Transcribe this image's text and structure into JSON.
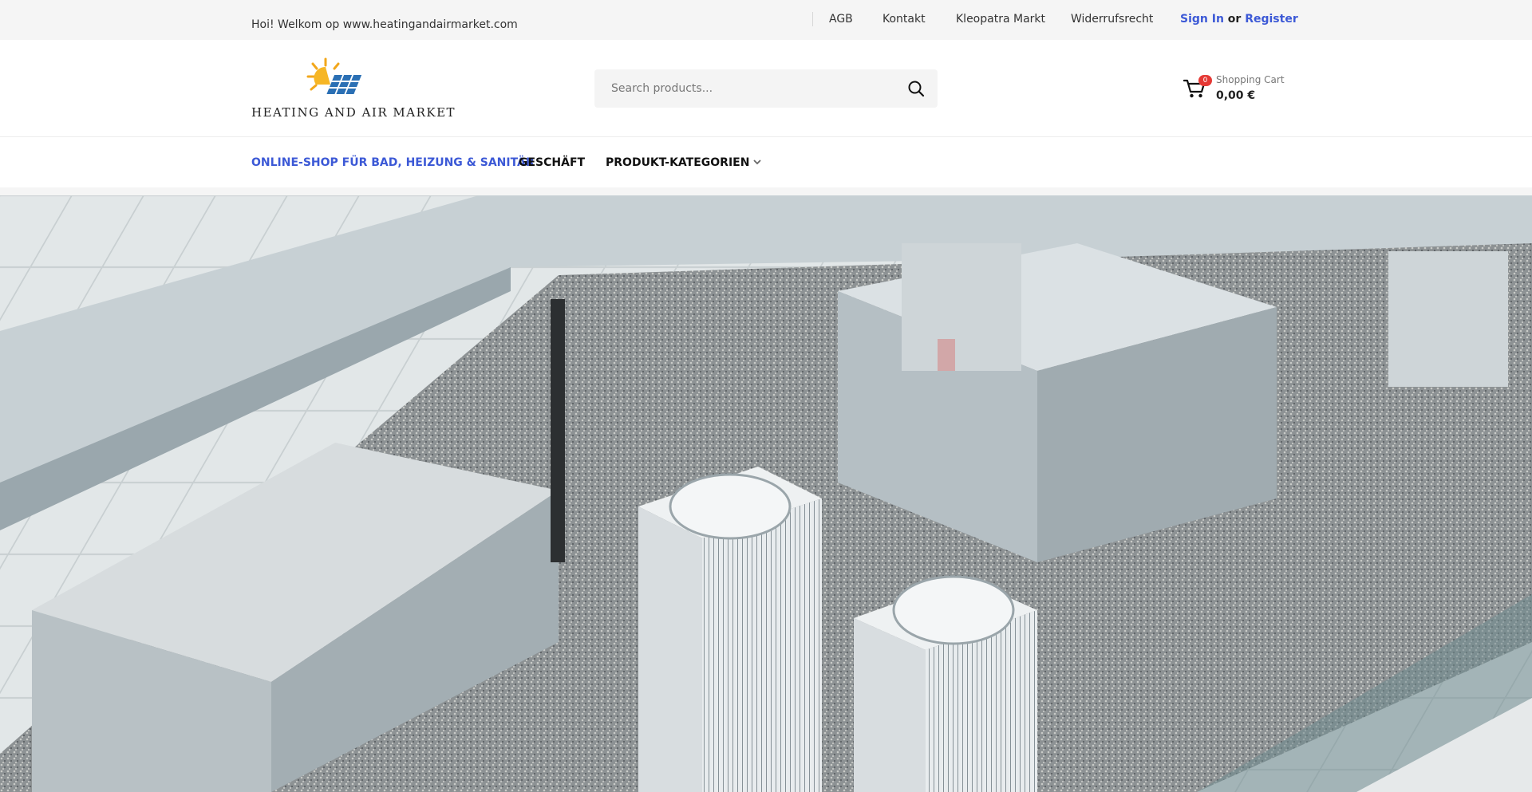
{
  "topbar": {
    "welcome": "Hoi! Welkom op www.heatingandairmarket.com",
    "links": [
      {
        "label": "AGB"
      },
      {
        "label": "Kontakt"
      },
      {
        "label": "Kleopatra Markt"
      },
      {
        "label": "Widerrufsrecht"
      }
    ],
    "sign_in": "Sign In",
    "or": "or",
    "register": "Register"
  },
  "header": {
    "logo_text": "HEATING AND AIR MARKET",
    "search_placeholder": "Search products...",
    "cart": {
      "label": "Shopping Cart",
      "count": "0",
      "total": "0,00 €"
    }
  },
  "nav": {
    "items": [
      {
        "label": "ONLINE-SHOP FÜR BAD, HEIZUNG & SANITÄR",
        "active": true
      },
      {
        "label": "GESCHÄFT"
      },
      {
        "label": "PRODUKT-KATEGORIEN"
      }
    ]
  },
  "colors": {
    "accent": "#3c59d6",
    "badge": "#e53935",
    "topbar_bg": "#f5f5f5"
  }
}
